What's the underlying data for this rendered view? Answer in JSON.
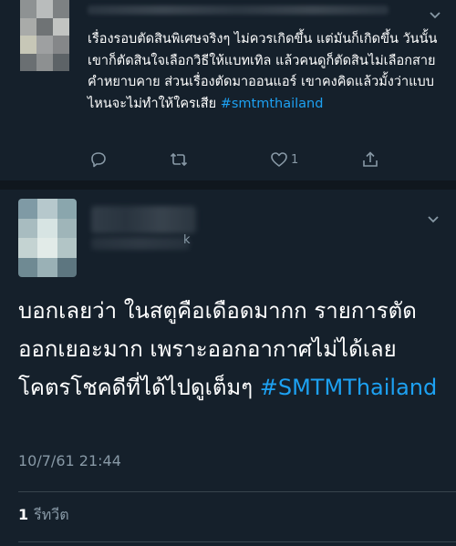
{
  "colors": {
    "background": "#15202b",
    "hashtag": "#1da1f2",
    "secondary_text": "#8899a6",
    "divider": "#38444d"
  },
  "tweet1": {
    "text": "เรื่องรอบตัดสินพิเศษจริงๆ ไม่ควรเกิดขึ้น แต่มันก็เกิดขึ้น วันนั้นเขาก็ตัดสินใจเลือกวิธีให้แบทเทิล แล้วคนดูก็ตัดสินไม่เลือกสายคำหยาบคาย ส่วนเรื่องตัดมาออนแอร์ เขาคงคิดแล้วมั้งว่าแบบไหนจะไม่ทำให้ใครเสีย",
    "hashtag": "#smtmthailand",
    "like_count": "1",
    "icons": [
      "reply-icon",
      "retweet-icon",
      "like-icon",
      "share-icon",
      "chevron-down-icon"
    ]
  },
  "tweet2": {
    "text": "บอกเลยว่า ในสตูคือเดือดมากก รายการตัดออกเยอะมาก เพราะออกอากาศไม่ได้เลย โคตรโชคดีที่ได้ไปดูเต็มๆ",
    "hashtag": "#SMTMThailand",
    "handle_tail": "k",
    "timestamp": "10/7/61 21:44",
    "retweet_count": "1",
    "retweet_label": "รีทวีต"
  }
}
